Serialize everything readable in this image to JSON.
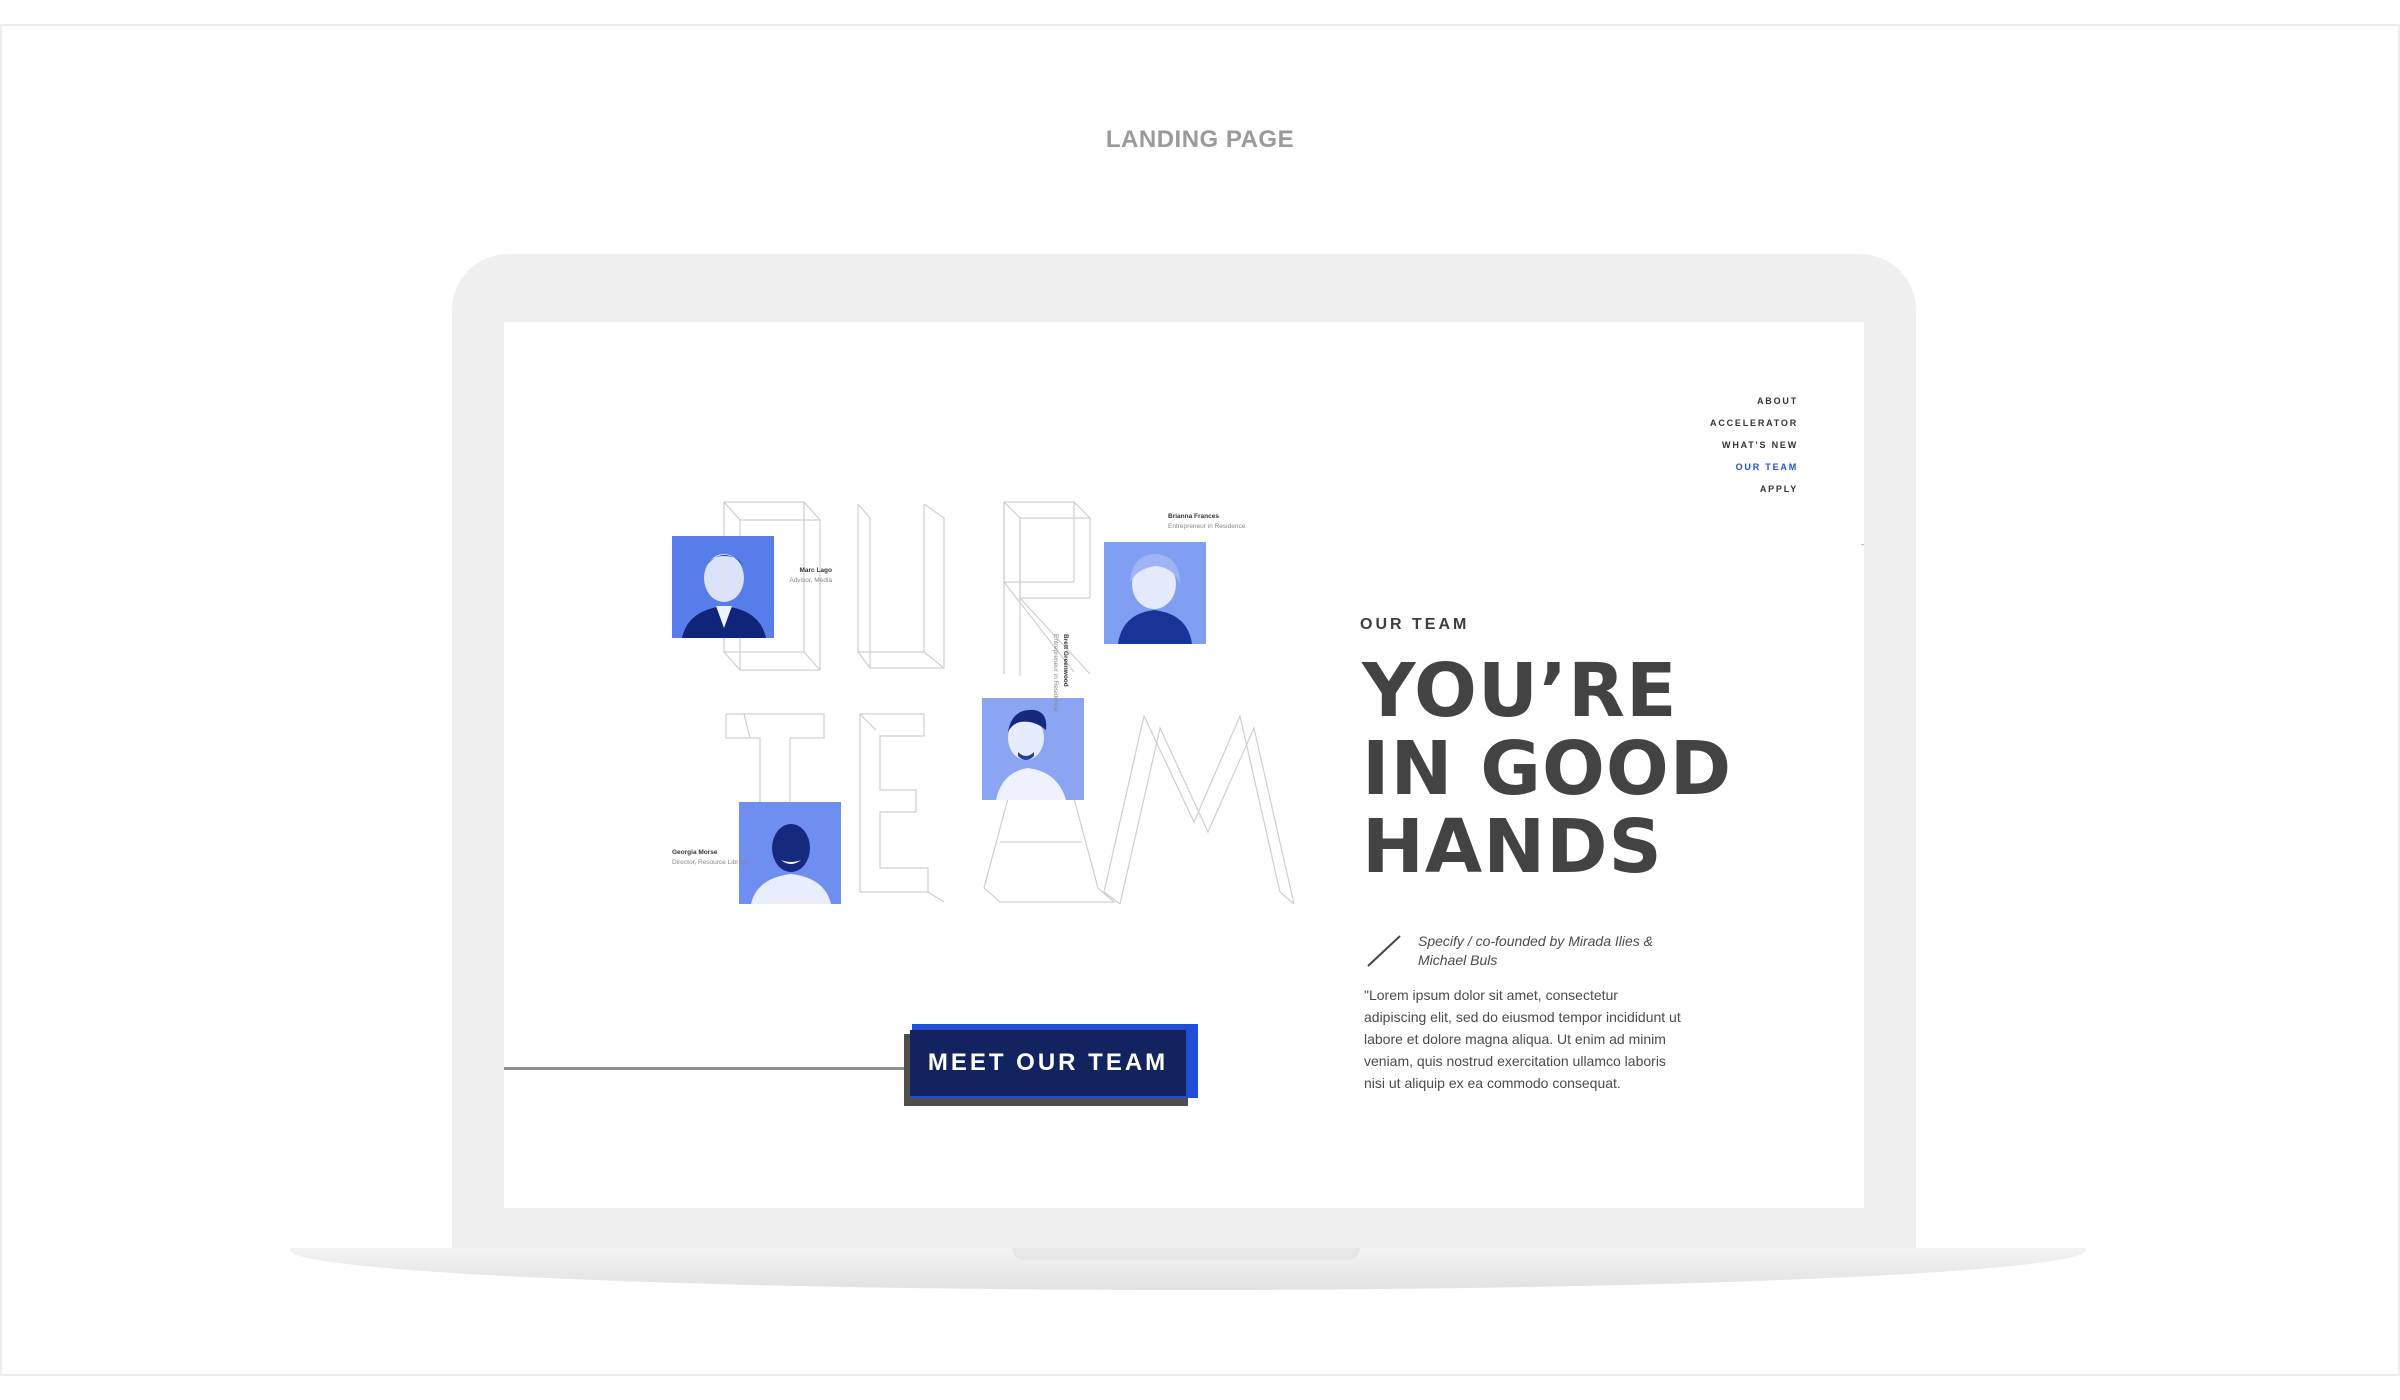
{
  "presentation": {
    "title": "LANDING PAGE"
  },
  "nav": {
    "items": [
      {
        "label": "ABOUT",
        "active": false
      },
      {
        "label": "ACCELERATOR",
        "active": false
      },
      {
        "label": "WHAT'S NEW",
        "active": false
      },
      {
        "label": "OUR TEAM",
        "active": true
      },
      {
        "label": "APPLY",
        "active": false
      }
    ]
  },
  "team": {
    "members": [
      {
        "name": "Marc Lago",
        "role": "Advisor, Media"
      },
      {
        "name": "Brianna Frances",
        "role": "Entrepreneur in Residence"
      },
      {
        "name": "Brett Greenwood",
        "role": "Entrepreneur in Residence"
      },
      {
        "name": "Georgia Morse",
        "role": "Director, Resource Library"
      }
    ]
  },
  "hero": {
    "eyebrow": "OUR TEAM",
    "headline_lines": [
      "YOU’RE",
      "IN GOOD",
      "HANDS"
    ],
    "credit": "Specify /  co-founded by Mirada Ilies & Michael Buls",
    "body": "\"Lorem ipsum dolor sit amet, consectetur adipiscing elit, sed do eiusmod tempor incididunt ut labore et dolore magna aliqua. Ut enim ad minim veniam, quis nostrud exercitation ullamco laboris nisi ut aliquip ex ea commodo consequat.",
    "cta_label": "MEET OUR TEAM"
  },
  "colors": {
    "accent": "#1f4fd6",
    "cta_dark": "#12235f",
    "headline": "#434343"
  }
}
